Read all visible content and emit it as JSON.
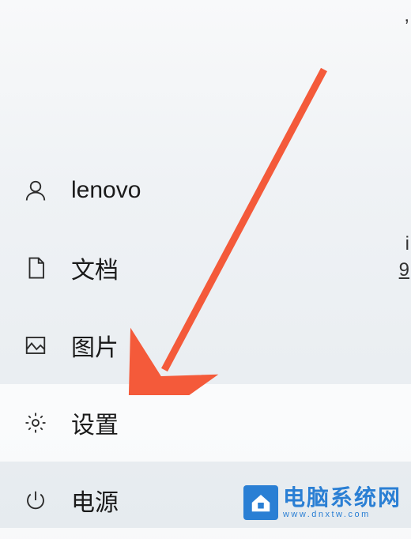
{
  "menu": {
    "items": [
      {
        "icon": "user-icon",
        "label": "lenovo"
      },
      {
        "icon": "document-icon",
        "label": "文档"
      },
      {
        "icon": "pictures-icon",
        "label": "图片"
      },
      {
        "icon": "settings-icon",
        "label": "设置",
        "highlighted": true
      },
      {
        "icon": "power-icon",
        "label": "电源"
      }
    ]
  },
  "edge": {
    "t1": ",",
    "t2": "i",
    "t3": "9"
  },
  "watermark": {
    "title": "电脑系统网",
    "url": "www.dnxtw.com"
  },
  "annotation": {
    "arrow_color": "#f45a3a"
  }
}
